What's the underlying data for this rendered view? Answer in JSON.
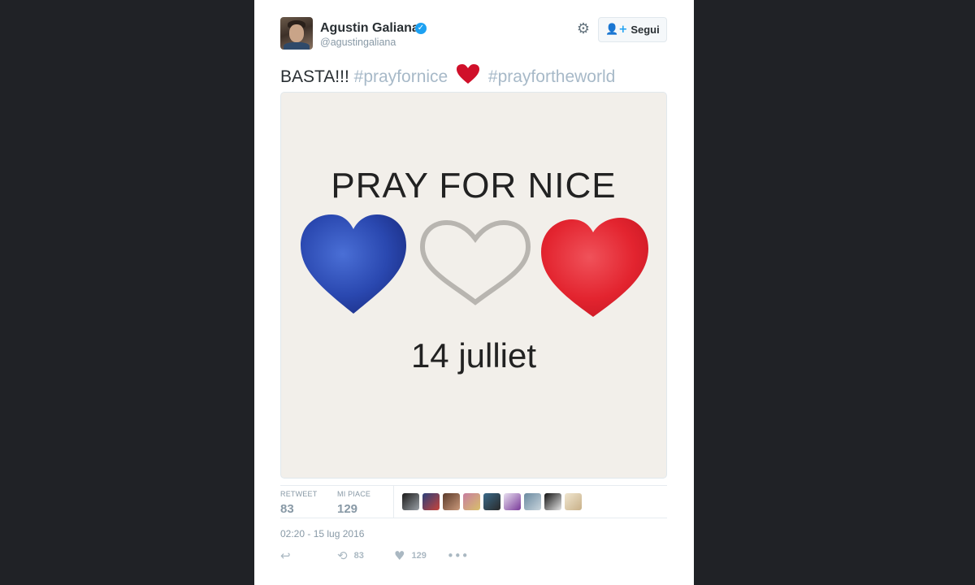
{
  "tweet": {
    "display_name": "Agustin Galiana",
    "handle": "@agustingaliana",
    "follow_label": "Segui",
    "text_main": "BASTA!!!",
    "hashtag_1": "#prayfornice",
    "hashtag_2": "#prayfortheworld",
    "media_title": "PRAY FOR NICE",
    "media_date": "14 julliet",
    "timestamp": "02:20 - 15 lug 2016"
  },
  "stats": {
    "retweet_label": "RETWEET",
    "retweet_count": "83",
    "likes_label": "MI PIACE",
    "likes_count": "129"
  },
  "actions": {
    "reply_icon": "reply-icon",
    "retweet_count": "83",
    "like_count": "129"
  },
  "colors": {
    "background": "#202226",
    "card": "#ffffff",
    "hashtag": "#a7b9c8",
    "verified": "#1da1f2",
    "blue_heart": "#2c4fb5",
    "red_heart": "#e02030",
    "emoji_heart": "#d0102a"
  },
  "likers": [
    "liker-avatar-1",
    "liker-avatar-2",
    "liker-avatar-3",
    "liker-avatar-4",
    "liker-avatar-5",
    "liker-avatar-6",
    "liker-avatar-7",
    "liker-avatar-8",
    "liker-avatar-9"
  ]
}
